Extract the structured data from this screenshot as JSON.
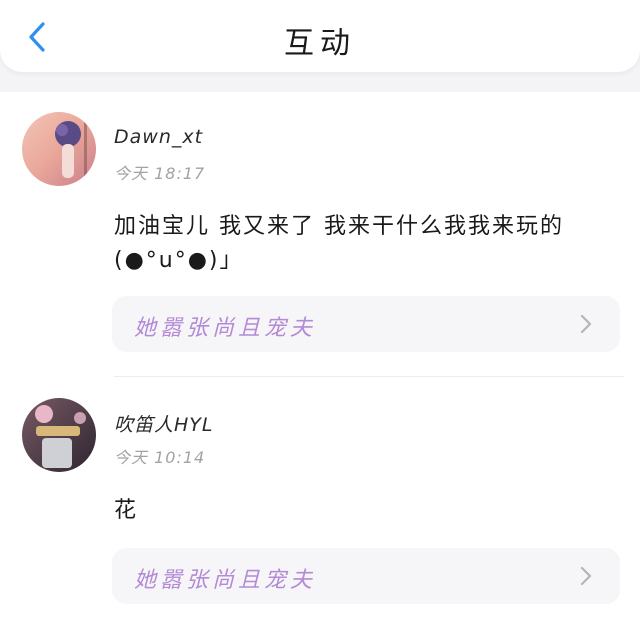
{
  "header": {
    "title": "互动",
    "back_icon": "chevron-left-icon",
    "accent_color": "#2f8ff0"
  },
  "comments": [
    {
      "username": "Dawn_xt",
      "time": "今天 18:17",
      "text": "加油宝儿 我又来了 我来干什么我我来玩的(●°u°●)」",
      "source": "她嚣张尚且宠夫",
      "avatar_icon": "avatar-image"
    },
    {
      "username": "吹笛人HYL",
      "time": "今天 10:14",
      "text": "花",
      "source": "她嚣张尚且宠夫",
      "avatar_icon": "avatar-image"
    }
  ],
  "colors": {
    "source_text": "#b48ad6",
    "time_text": "#a3a3a3"
  }
}
